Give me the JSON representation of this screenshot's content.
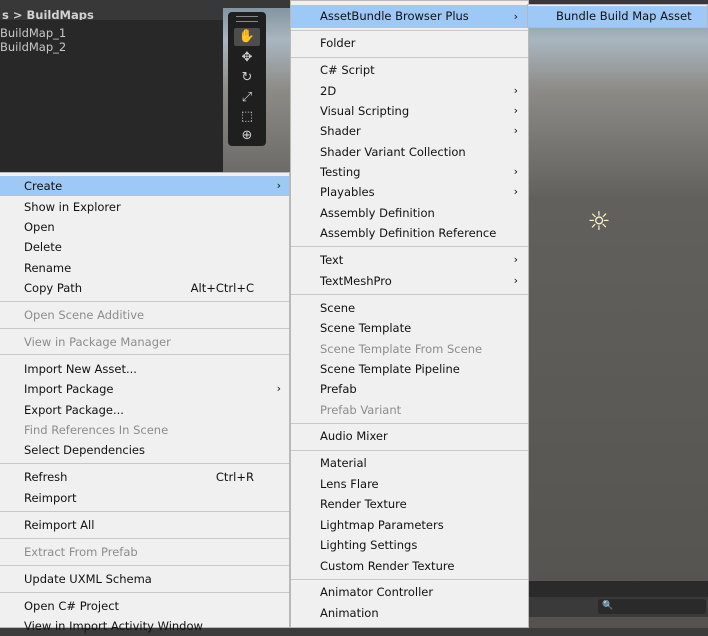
{
  "project": {
    "breadcrumb": "s > BuildMaps",
    "assets": [
      "BuildMap_1",
      "BuildMap_2"
    ]
  },
  "scene": {
    "tools": [
      "hand-tool",
      "move-tool",
      "rotate-tool",
      "scale-tool",
      "rect-tool",
      "transform-tool"
    ],
    "search_placeholder": "🔍"
  },
  "left_menu": {
    "items": [
      {
        "label": "Create",
        "arrow": "›",
        "highlight": true
      },
      {
        "label": "Show in Explorer"
      },
      {
        "label": "Open"
      },
      {
        "label": "Delete"
      },
      {
        "label": "Rename"
      },
      {
        "label": "Copy Path",
        "shortcut": "Alt+Ctrl+C"
      },
      {
        "label": "Open Scene Additive",
        "disabled": true
      },
      {
        "label": "View in Package Manager",
        "disabled": true
      },
      {
        "label": "Import New Asset..."
      },
      {
        "label": "Import Package",
        "arrow": "›"
      },
      {
        "label": "Export Package..."
      },
      {
        "label": "Find References In Scene",
        "disabled": true
      },
      {
        "label": "Select Dependencies"
      },
      {
        "label": "Refresh",
        "shortcut": "Ctrl+R"
      },
      {
        "label": "Reimport"
      },
      {
        "label": "Reimport All"
      },
      {
        "label": "Extract From Prefab",
        "disabled": true
      },
      {
        "label": "Update UXML Schema"
      },
      {
        "label": "Open C# Project"
      },
      {
        "label": "View in Import Activity Window"
      }
    ]
  },
  "mid_menu": {
    "items": [
      {
        "label": "AssetBundle Browser Plus",
        "arrow": "›",
        "highlight": true
      },
      {
        "label": "Folder"
      },
      {
        "label": "C# Script"
      },
      {
        "label": "2D",
        "arrow": "›"
      },
      {
        "label": "Visual Scripting",
        "arrow": "›"
      },
      {
        "label": "Shader",
        "arrow": "›"
      },
      {
        "label": "Shader Variant Collection"
      },
      {
        "label": "Testing",
        "arrow": "›"
      },
      {
        "label": "Playables",
        "arrow": "›"
      },
      {
        "label": "Assembly Definition"
      },
      {
        "label": "Assembly Definition Reference"
      },
      {
        "label": "Text",
        "arrow": "›"
      },
      {
        "label": "TextMeshPro",
        "arrow": "›"
      },
      {
        "label": "Scene"
      },
      {
        "label": "Scene Template"
      },
      {
        "label": "Scene Template From Scene",
        "disabled": true
      },
      {
        "label": "Scene Template Pipeline"
      },
      {
        "label": "Prefab"
      },
      {
        "label": "Prefab Variant",
        "disabled": true
      },
      {
        "label": "Audio Mixer"
      },
      {
        "label": "Material"
      },
      {
        "label": "Lens Flare"
      },
      {
        "label": "Render Texture"
      },
      {
        "label": "Lightmap Parameters"
      },
      {
        "label": "Lighting Settings"
      },
      {
        "label": "Custom Render Texture"
      },
      {
        "label": "Animator Controller"
      },
      {
        "label": "Animation"
      }
    ]
  },
  "right_menu": {
    "items": [
      {
        "label": "Bundle Build Map Asset",
        "highlight": true
      }
    ]
  }
}
